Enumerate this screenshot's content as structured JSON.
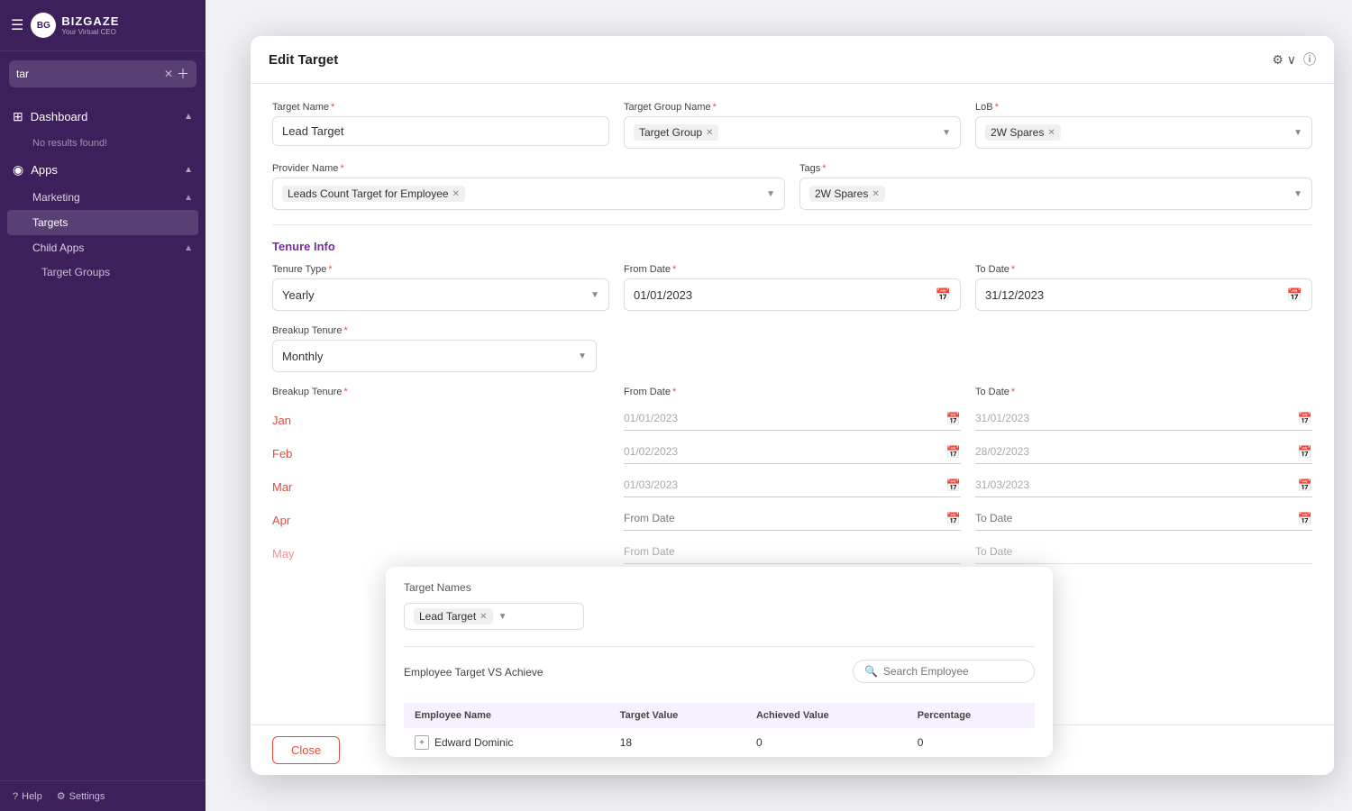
{
  "sidebar": {
    "logo_main": "BIZGAZE",
    "logo_sub": "Your Virtual CEO",
    "search_value": "tar",
    "nav": [
      {
        "id": "dashboard",
        "icon": "⊞",
        "label": "Dashboard",
        "arrow": "▲",
        "sub": [
          {
            "id": "no-result",
            "label": "No results found!",
            "active": false
          }
        ]
      },
      {
        "id": "apps",
        "icon": "◉",
        "label": "Apps",
        "arrow": "▲",
        "sub": [
          {
            "id": "marketing",
            "label": "Marketing",
            "arrow": "▲"
          },
          {
            "id": "targets",
            "label": "Targets",
            "active": true
          },
          {
            "id": "child-apps",
            "label": "Child Apps",
            "arrow": "▲"
          },
          {
            "id": "target-groups",
            "label": "Target Groups"
          }
        ]
      }
    ],
    "footer": [
      {
        "id": "help",
        "icon": "?",
        "label": "Help"
      },
      {
        "id": "settings",
        "icon": "⚙",
        "label": "Settings"
      }
    ]
  },
  "modal": {
    "title": "Edit Target",
    "fields": {
      "target_name_label": "Target Name",
      "target_name_value": "Lead Target",
      "target_group_label": "Target Group Name",
      "target_group_value": "Target Group",
      "lob_label": "LoB",
      "lob_value": "2W Spares",
      "provider_label": "Provider Name",
      "provider_value": "Leads Count Target for Employee",
      "tags_label": "Tags",
      "tags_value": "2W Spares"
    },
    "tenure_info": {
      "section_title": "Tenure Info",
      "tenure_type_label": "Tenure Type",
      "tenure_type_value": "Yearly",
      "from_date_label": "From Date",
      "from_date_value": "01/01/2023",
      "to_date_label": "To Date",
      "to_date_value": "31/12/2023",
      "breakup_label": "Breakup Tenure",
      "breakup_value": "Monthly",
      "breakups": [
        {
          "name": "Jan",
          "from": "01/01/2023",
          "to": "31/01/2023"
        },
        {
          "name": "Feb",
          "from": "01/02/2023",
          "to": "28/02/2023"
        },
        {
          "name": "Mar",
          "from": "01/03/2023",
          "to": "31/03/2023"
        },
        {
          "name": "Apr",
          "from": "",
          "to": ""
        },
        {
          "name": "May",
          "from": "",
          "to": ""
        }
      ]
    },
    "close_label": "Close"
  },
  "popup": {
    "target_names_label": "Target Names",
    "target_name_selected": "Lead Target",
    "employee_target_label": "Employee Target VS Achieve",
    "search_placeholder": "Search Employee",
    "table": {
      "headers": [
        "Employee Name",
        "Target Value",
        "Achieved Value",
        "Percentage"
      ],
      "rows": [
        {
          "name": "Edward Dominic",
          "target_value": "18",
          "achieved_value": "0",
          "percentage": "0"
        }
      ]
    }
  }
}
